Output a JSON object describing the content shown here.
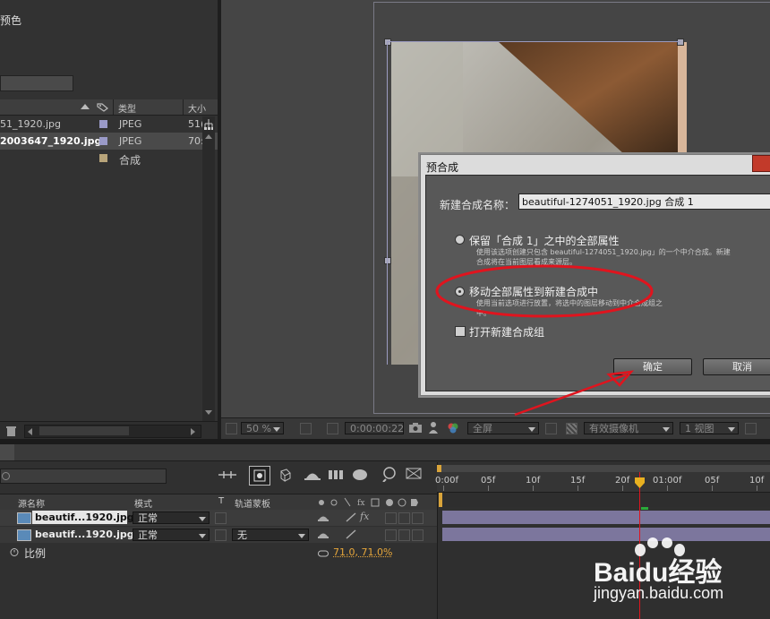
{
  "project_panel": {
    "top_label": "预色",
    "columns": {
      "type": "类型",
      "size": "大小"
    },
    "items": [
      {
        "name": "51_1920.jpg",
        "type": "JPEG",
        "size": "51(",
        "color": "#9a9ac8"
      },
      {
        "name": "2003647_1920.jpg",
        "type": "JPEG",
        "size": "70:",
        "color": "#9a9ac8"
      },
      {
        "name": "",
        "type": "合成",
        "size": "",
        "color": "#b8a47a"
      }
    ]
  },
  "viewer": {
    "zoom": "50 %",
    "timecode": "0:00:00:22",
    "resolution": "全屏",
    "camera": "有效摄像机",
    "views": "1 视图"
  },
  "dialog": {
    "title": "预合成",
    "name_label": "新建合成名称：",
    "name_value": "beautiful-1274051_1920.jpg 合成 1",
    "option1_label": "保留「合成 1」之中的全部属性",
    "option1_desc_line1": "使用该选项创建只包含 beautiful-1274051_1920.jpg」的一个中介合成。新建",
    "option1_desc_line2": "合成将在当前图层看成来源层。",
    "option2_label": "移动全部属性到新建合成中",
    "option2_desc_line1": "使用当前选项进行放置，将选中的图层移动到中介合成组之",
    "option2_desc_line2": "中。",
    "open_label": "打开新建合成组",
    "ok_label": "确定",
    "cancel_label": "取消"
  },
  "timeline": {
    "col_source": "源名称",
    "col_mode": "模式",
    "col_t": "T",
    "col_trackmatte": "轨道蒙板",
    "ruler": [
      "0:00f",
      "05f",
      "10f",
      "15f",
      "20f",
      "01:00f",
      "05f",
      "10f"
    ],
    "layers": [
      {
        "name": "beautif...1920.jpg",
        "mode": "正常",
        "trackmatte": ""
      },
      {
        "name": "beautif...1920.jpg",
        "mode": "正常",
        "trackmatte": "无"
      }
    ],
    "property_label": "比例",
    "property_value": "71.0, 71.0%"
  },
  "watermark": {
    "brand": "Baidu经验",
    "url": "jingyan.baidu.com"
  },
  "colors": {
    "accent_red": "#e0141e",
    "property_value": "#e8a73a",
    "layer_bar": "#8a82b0",
    "playhead": "#e0141e"
  }
}
